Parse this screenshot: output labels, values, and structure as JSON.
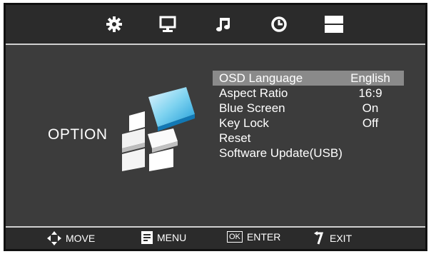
{
  "tabs": [
    {
      "icon": "gear-icon"
    },
    {
      "icon": "monitor-icon"
    },
    {
      "icon": "music-note-icon"
    },
    {
      "icon": "clock-icon"
    },
    {
      "icon": "option-tab-icon"
    }
  ],
  "section_title": "OPTION",
  "menu": {
    "items": [
      {
        "label": "OSD  Language",
        "value": "English",
        "selected": true
      },
      {
        "label": "Aspect  Ratio",
        "value": "16:9"
      },
      {
        "label": "Blue  Screen",
        "value": "On"
      },
      {
        "label": "Key  Lock",
        "value": "Off"
      },
      {
        "label": "Reset",
        "value": ""
      },
      {
        "label": "Software  Update(USB)",
        "value": ""
      }
    ]
  },
  "footer": {
    "move": "MOVE",
    "menu": "MENU",
    "ok_key": "OK",
    "enter": "ENTER",
    "exit": "EXIT"
  },
  "colors": {
    "background": "#3c3c3c",
    "highlight": "#8a8a8a",
    "text": "#ffffff"
  }
}
